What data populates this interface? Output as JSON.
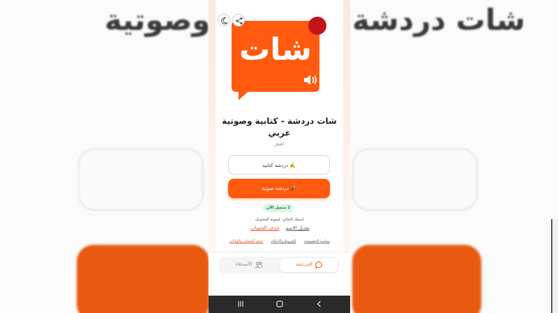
{
  "background": {
    "title_left": "وصوتية",
    "title_right": "شات دردشة"
  },
  "app": {
    "logo_text": "شات",
    "title": "شات دردشة - كتابية وصوتية عربي",
    "rating": "اعتبار"
  },
  "buttons": {
    "text_chat": "✍️ دردشة كتابية",
    "voice_chat": "🎤 دردشة صوتية"
  },
  "status": {
    "online": "2 متصل الآن"
  },
  "account": {
    "current_name": "اسمك الحالي: ليموتة المحترف",
    "edit_name": "تعديل الاسم",
    "delete_account": "حذف الحساب"
  },
  "footer_links": {
    "privacy": "سياسة الخصوصية",
    "terms": "الشروط والاحكام",
    "delete_data": "حذف الحساب والبيانات"
  },
  "bottom_nav": {
    "chat": "الدردشة",
    "friends": "الأصدقاء"
  },
  "colors": {
    "accent": "#ff5a0f",
    "danger": "#e04b2a",
    "online_bg": "#dcf6e6"
  },
  "icons": {
    "theme": "moon-icon",
    "share": "share-icon",
    "chat": "chat-bubble-icon",
    "friends": "users-icon",
    "speaker": "speaker-icon"
  }
}
